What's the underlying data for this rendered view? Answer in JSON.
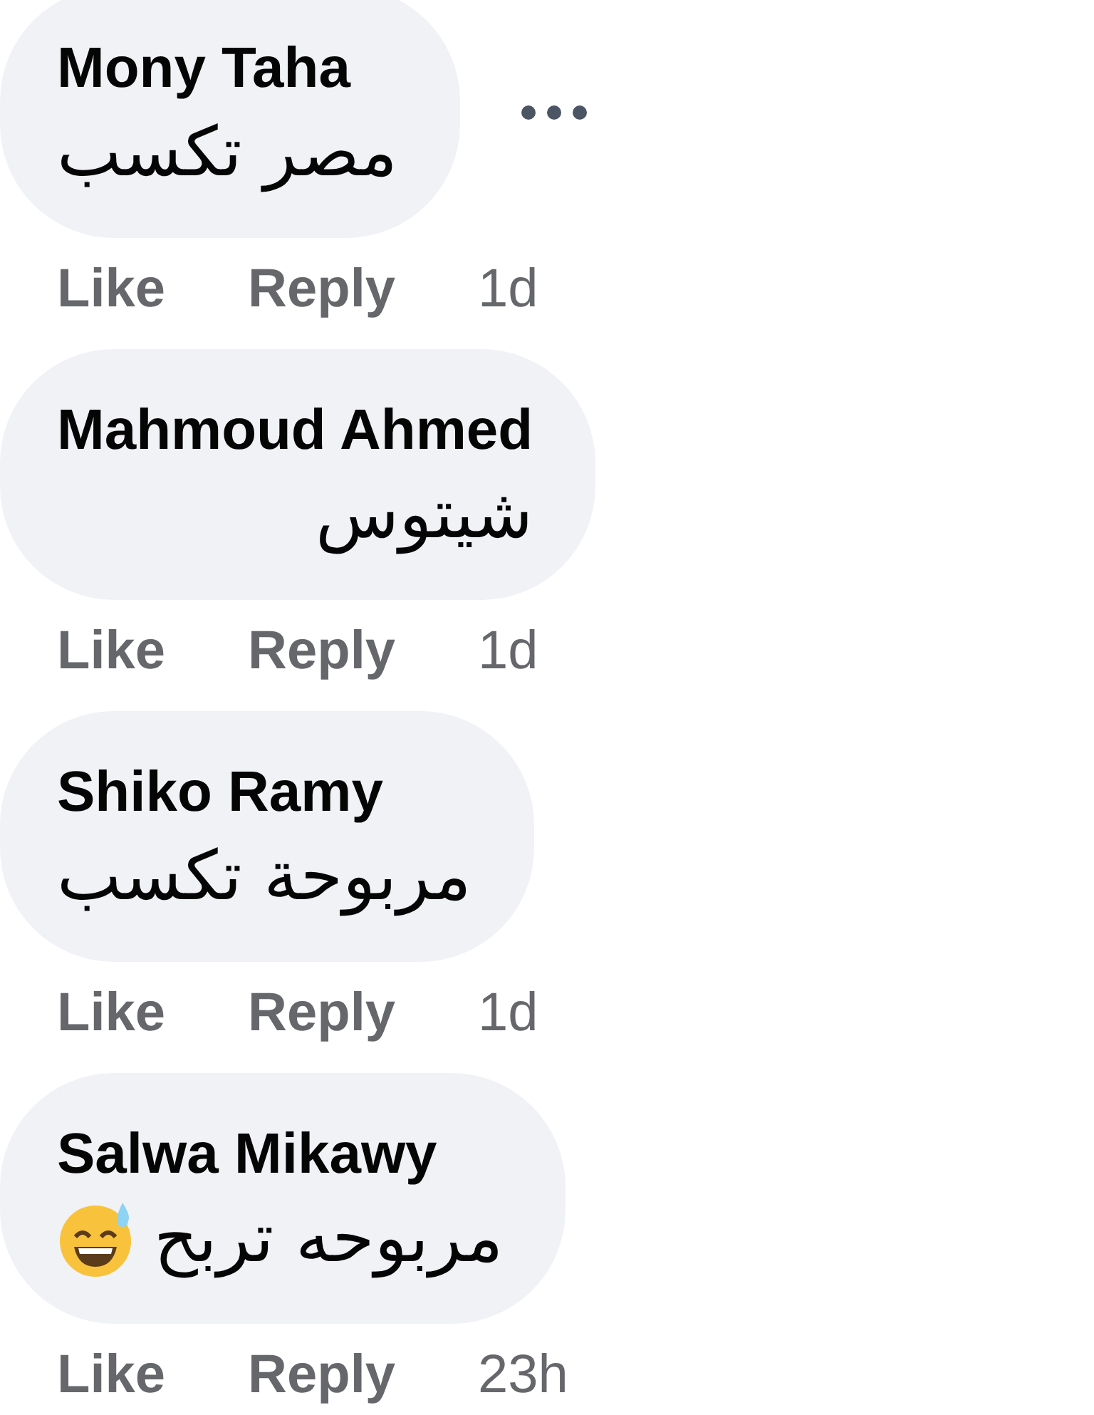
{
  "comments": [
    {
      "author": "Mony Taha",
      "text": "مصر تكسب",
      "emoji": false,
      "menu": true,
      "like": "Like",
      "reply": "Reply",
      "time": "1d"
    },
    {
      "author": "Mahmoud Ahmed",
      "text": "شيتوس",
      "emoji": false,
      "menu": false,
      "like": "Like",
      "reply": "Reply",
      "time": "1d"
    },
    {
      "author": "Shiko Ramy",
      "text": "مربوحة تكسب",
      "emoji": false,
      "menu": false,
      "like": "Like",
      "reply": "Reply",
      "time": "1d"
    },
    {
      "author": "Salwa Mikawy",
      "text": "مربوحه تربح",
      "emoji": true,
      "menu": false,
      "like": "Like",
      "reply": "Reply",
      "time": "23h"
    }
  ]
}
